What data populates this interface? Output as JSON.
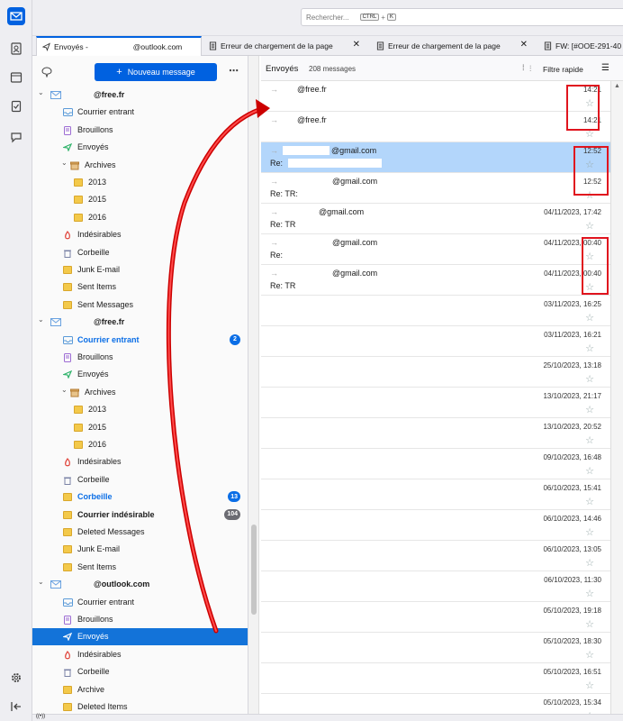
{
  "search": {
    "placeholder": "Rechercher...",
    "key1": "CTRL",
    "key2": "K"
  },
  "tabs": [
    {
      "label": "Envoyés -",
      "suffix": "@outlook.com"
    },
    {
      "label": "Erreur de chargement de la page"
    },
    {
      "label": "Erreur de chargement de la page"
    },
    {
      "label": "FW: [#OOE-291-40"
    }
  ],
  "new_message_label": "Nouveau message",
  "folders": [
    {
      "label": "@free.fr",
      "kind": "account",
      "bold": true
    },
    {
      "label": "Courrier entrant",
      "kind": "inbox"
    },
    {
      "label": "Brouillons",
      "kind": "drafts"
    },
    {
      "label": "Envoyés",
      "kind": "sent"
    },
    {
      "label": "Archives",
      "kind": "archive"
    },
    {
      "label": "2013",
      "kind": "folder"
    },
    {
      "label": "2015",
      "kind": "folder"
    },
    {
      "label": "2016",
      "kind": "folder"
    },
    {
      "label": "Indésirables",
      "kind": "junk"
    },
    {
      "label": "Corbeille",
      "kind": "trash"
    },
    {
      "label": "Junk E-mail",
      "kind": "folder"
    },
    {
      "label": "Sent Items",
      "kind": "folder"
    },
    {
      "label": "Sent Messages",
      "kind": "folder"
    },
    {
      "label": "@free.fr",
      "kind": "account",
      "bold": true
    },
    {
      "label": "Courrier entrant",
      "kind": "inbox",
      "bold": true,
      "blue": true,
      "badge": "2"
    },
    {
      "label": "Brouillons",
      "kind": "drafts"
    },
    {
      "label": "Envoyés",
      "kind": "sent"
    },
    {
      "label": "Archives",
      "kind": "archive"
    },
    {
      "label": "2013",
      "kind": "folder"
    },
    {
      "label": "2015",
      "kind": "folder"
    },
    {
      "label": "2016",
      "kind": "folder"
    },
    {
      "label": "Indésirables",
      "kind": "junk"
    },
    {
      "label": "Corbeille",
      "kind": "trash"
    },
    {
      "label": "Corbeille",
      "kind": "folder",
      "bold": true,
      "blue": true,
      "badge": "13"
    },
    {
      "label": "Courrier indésirable",
      "kind": "folder",
      "bold": true,
      "badge": "104",
      "badge_gray": true
    },
    {
      "label": "Deleted Messages",
      "kind": "folder"
    },
    {
      "label": "Junk E-mail",
      "kind": "folder"
    },
    {
      "label": "Sent Items",
      "kind": "folder"
    },
    {
      "label": "@outlook.com",
      "kind": "account",
      "bold": true
    },
    {
      "label": "Courrier entrant",
      "kind": "inbox"
    },
    {
      "label": "Brouillons",
      "kind": "drafts"
    },
    {
      "label": "Envoyés",
      "kind": "sent",
      "selected": true
    },
    {
      "label": "Indésirables",
      "kind": "junk"
    },
    {
      "label": "Corbeille",
      "kind": "trash"
    },
    {
      "label": "Archive",
      "kind": "folder"
    },
    {
      "label": "Deleted Items",
      "kind": "folder"
    }
  ],
  "thread_pane": {
    "folder": "Envoyés",
    "count": "208 messages",
    "quick_filter": "Filtre rapide"
  },
  "messages": [
    {
      "sender": "@free.fr",
      "subject": "",
      "date": "14:21"
    },
    {
      "sender": "@free.fr",
      "subject": "",
      "date": "14:21"
    },
    {
      "sender": "@gmail.com",
      "subject": "Re:",
      "date": "12:52",
      "selected": true
    },
    {
      "sender": "@gmail.com",
      "subject": "Re: TR:",
      "date": "12:52"
    },
    {
      "sender": "@gmail.com",
      "subject": "Re: TR",
      "date": "04/11/2023, 17:42"
    },
    {
      "sender": "@gmail.com",
      "subject": "Re:",
      "date": "04/11/2023, 00:40"
    },
    {
      "sender": "@gmail.com",
      "subject": "Re: TR",
      "date": "04/11/2023, 00:40"
    },
    {
      "sender": "",
      "subject": "",
      "date": "03/11/2023, 16:25"
    },
    {
      "sender": "",
      "subject": "",
      "date": "03/11/2023, 16:21"
    },
    {
      "sender": "",
      "subject": "",
      "date": "25/10/2023, 13:18"
    },
    {
      "sender": "",
      "subject": "",
      "date": "13/10/2023, 21:17"
    },
    {
      "sender": "",
      "subject": "",
      "date": "13/10/2023, 20:52"
    },
    {
      "sender": "",
      "subject": "",
      "date": "09/10/2023, 16:48"
    },
    {
      "sender": "",
      "subject": "",
      "date": "06/10/2023, 15:41"
    },
    {
      "sender": "",
      "subject": "",
      "date": "06/10/2023, 14:46"
    },
    {
      "sender": "",
      "subject": "",
      "date": "06/10/2023, 13:05"
    },
    {
      "sender": "",
      "subject": "",
      "date": "06/10/2023, 11:30"
    },
    {
      "sender": "",
      "subject": "",
      "date": "05/10/2023, 19:18"
    },
    {
      "sender": "",
      "subject": "",
      "date": "05/10/2023, 18:30"
    },
    {
      "sender": "",
      "subject": "",
      "date": "05/10/2023, 16:51"
    },
    {
      "sender": "",
      "subject": "",
      "date": "05/10/2023, 15:34"
    }
  ],
  "colors": {
    "accent": "#0061e0",
    "selected_folder": "#1373d9",
    "selected_message": "#b3d6fb",
    "annotation_red": "#e0141e",
    "unread_blue": "#0b6ee6"
  }
}
